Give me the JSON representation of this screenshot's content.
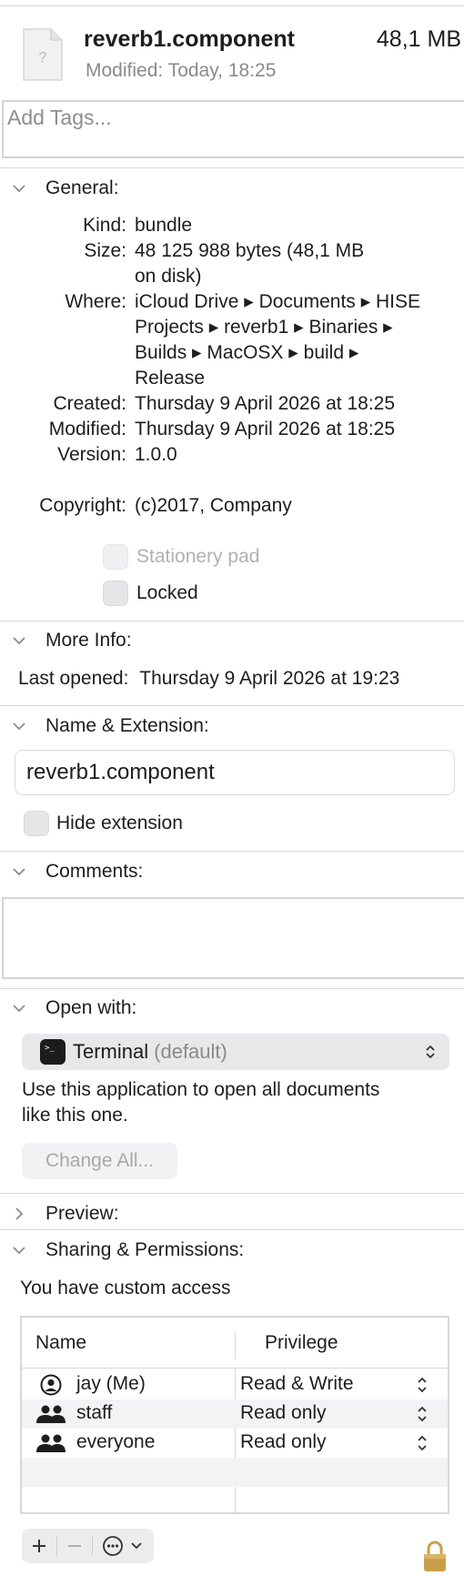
{
  "header": {
    "file_name": "reverb1.component",
    "file_size": "48,1 MB",
    "modified_label": "Modified:",
    "modified_value": "Today, 18:25"
  },
  "tags": {
    "placeholder": "Add Tags..."
  },
  "general": {
    "title": "General:",
    "rows": [
      {
        "label": "Kind:",
        "value": "bundle"
      },
      {
        "label": "Size:",
        "value": "48 125 988 bytes (48,1 MB",
        "value2": "on disk)"
      },
      {
        "label": "Where:",
        "value": "iCloud Drive ▸ Documents ▸ HISE",
        "value2": "Projects ▸ reverb1 ▸ Binaries ▸",
        "value3": "Builds ▸ MacOSX ▸ build ▸",
        "value4": "Release"
      },
      {
        "label": "Created:",
        "value": "Thursday 9 April 2026 at 18:25"
      },
      {
        "label": "Modified:",
        "value": "Thursday 9 April 2026 at 18:25"
      },
      {
        "label": "Version:",
        "value": "1.0.0"
      },
      {
        "label": "Copyright:",
        "value": "(c)2017, Company"
      }
    ],
    "stationery_label": "Stationery pad",
    "locked_label": "Locked"
  },
  "more_info": {
    "title": "More Info:",
    "last_opened_label": "Last opened:",
    "last_opened_value": "Thursday 9 April 2026 at 19:23"
  },
  "name_ext": {
    "title": "Name & Extension:",
    "name_value": "reverb1.component",
    "hide_ext_label": "Hide extension"
  },
  "comments": {
    "title": "Comments:"
  },
  "open_with": {
    "title": "Open with:",
    "app_name": "Terminal",
    "app_default": "(default)",
    "description_line1": "Use this application to open all documents",
    "description_line2": "like this one.",
    "change_all_label": "Change All..."
  },
  "preview": {
    "title": "Preview:"
  },
  "sharing": {
    "title": "Sharing & Permissions:",
    "access_text": "You have custom access",
    "col_name": "Name",
    "col_privilege": "Privilege",
    "rows": [
      {
        "name": "jay (Me)",
        "privilege": "Read & Write"
      },
      {
        "name": "staff",
        "privilege": "Read only"
      },
      {
        "name": "everyone",
        "privilege": "Read only"
      }
    ]
  },
  "icons": {
    "file": "document-icon",
    "chevron": "chevron-icon",
    "lock": "lock-icon",
    "add": "plus-icon",
    "remove": "minus-icon",
    "actions": "ellipsis-circle-icon"
  },
  "colors": {
    "muted_text": "#8a8a8e",
    "lock_gold": "#c9a04a"
  }
}
